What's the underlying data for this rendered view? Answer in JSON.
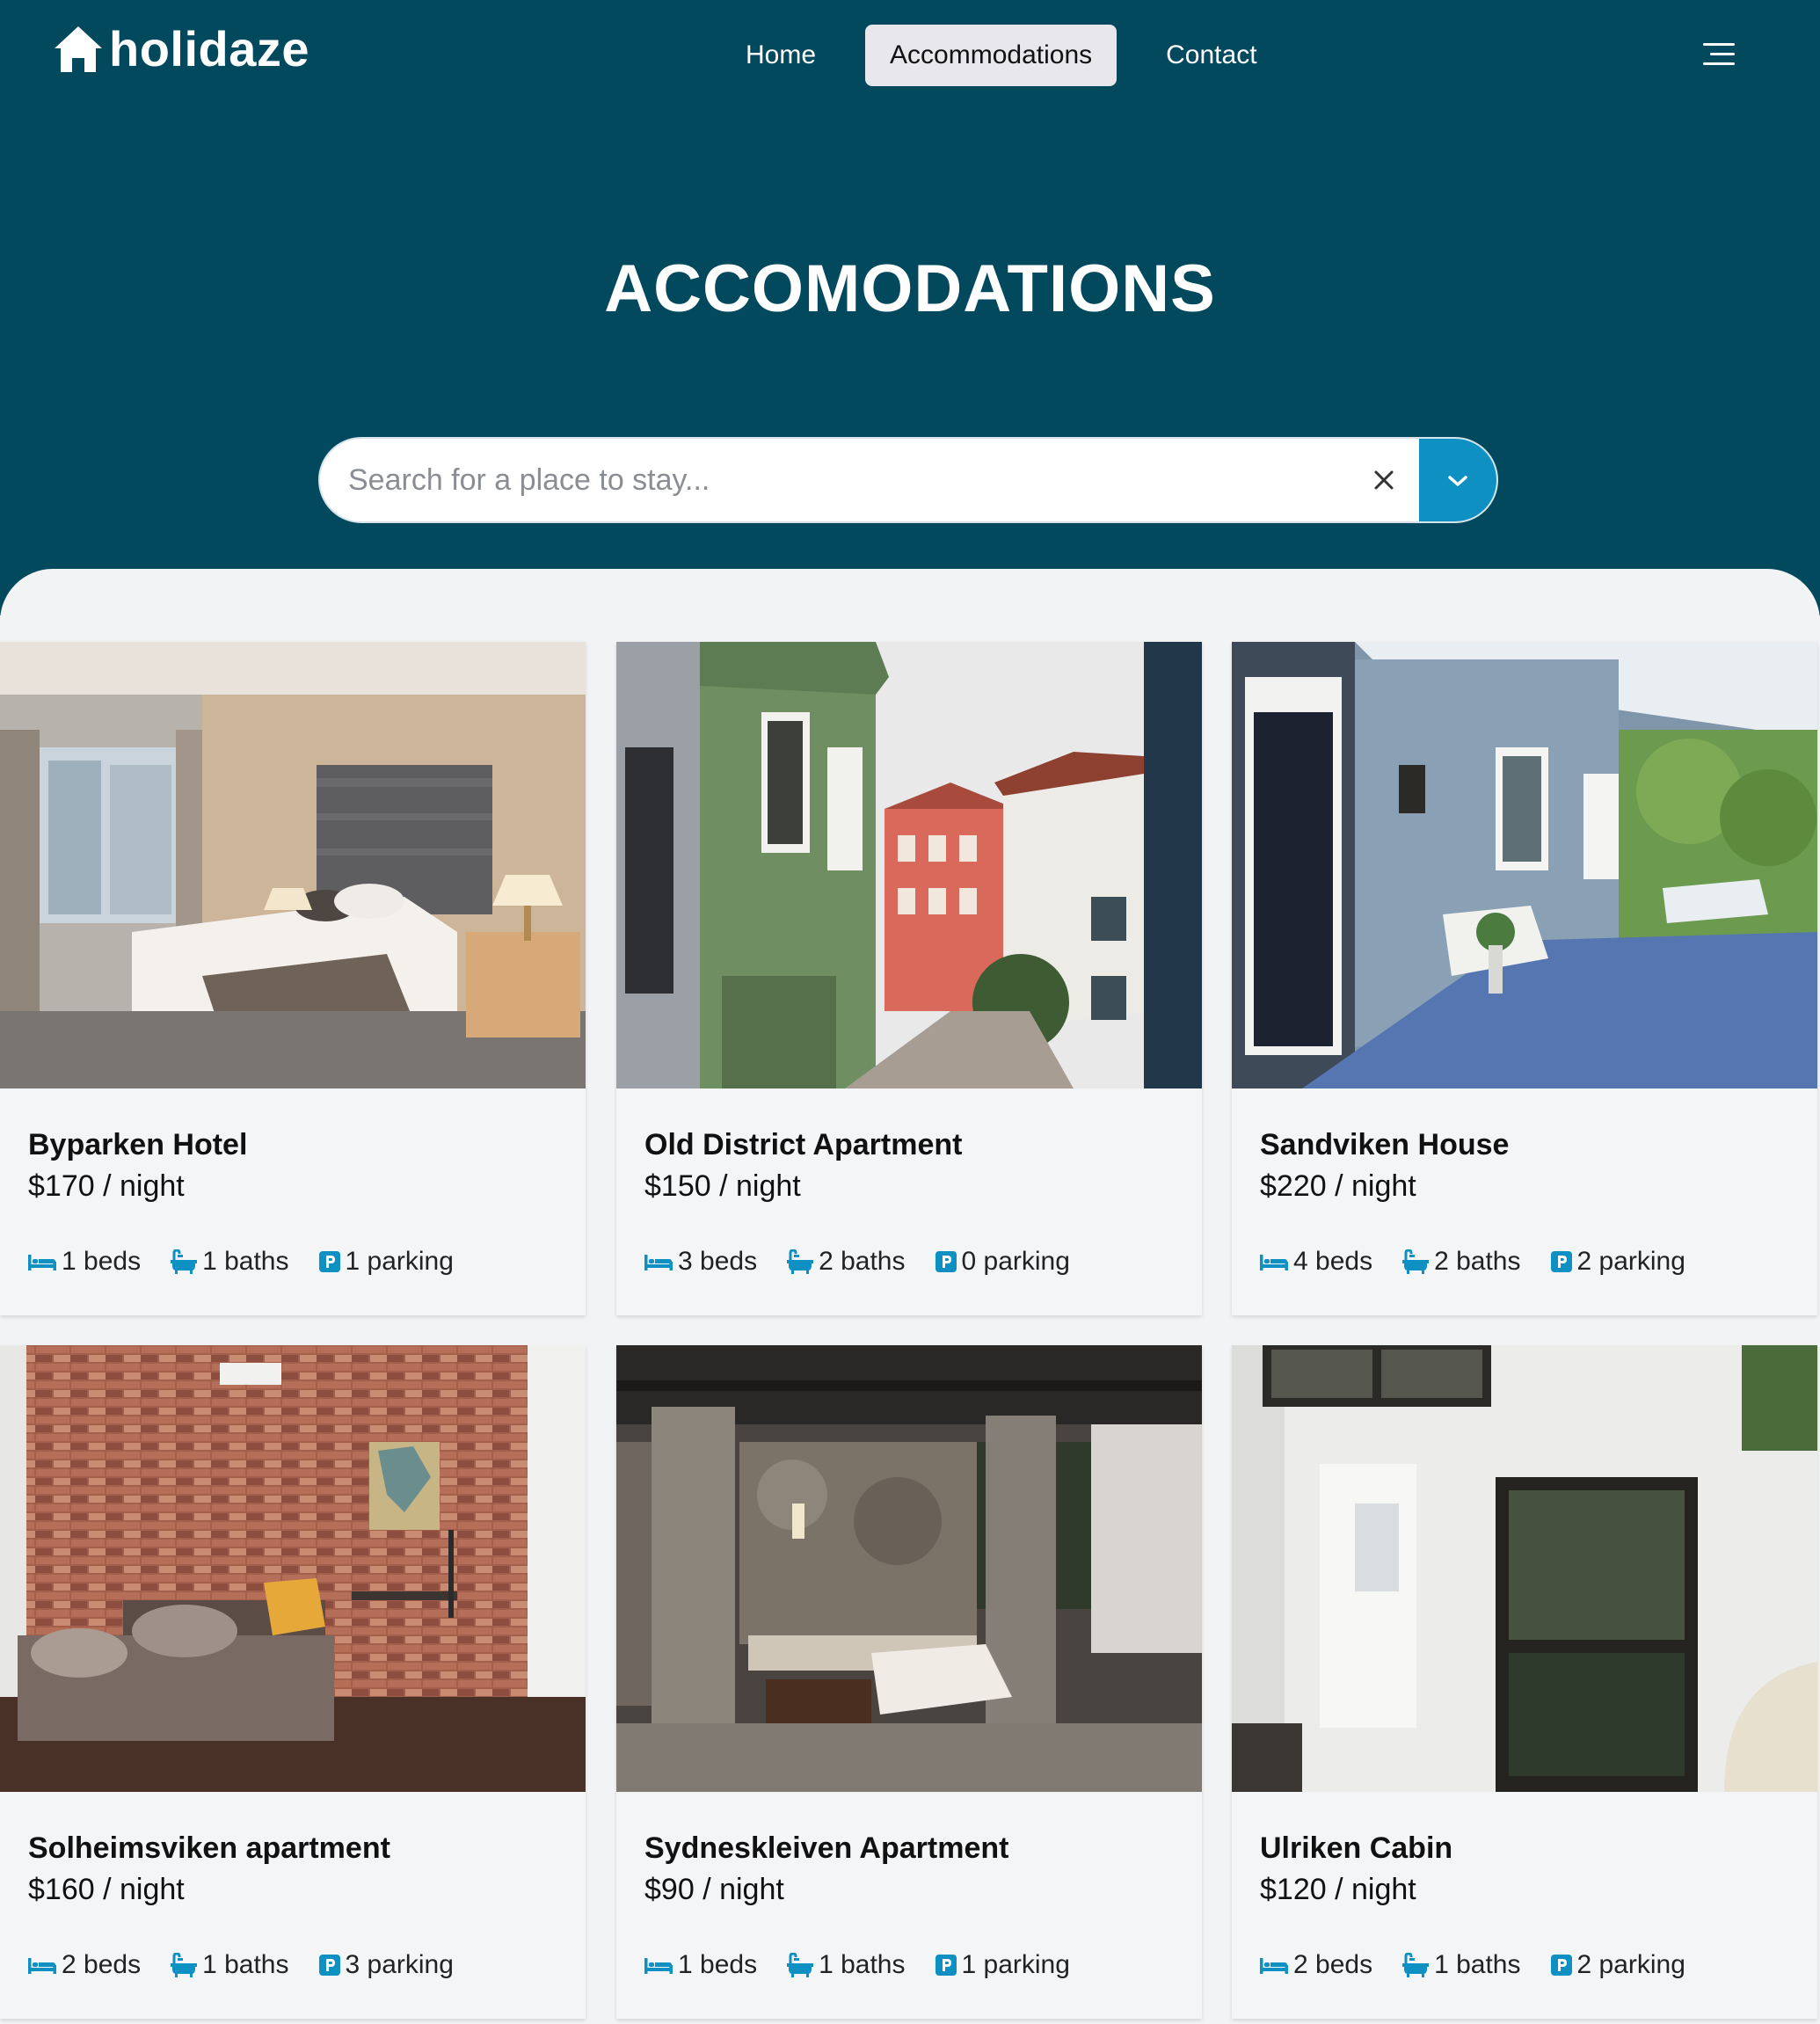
{
  "brand": {
    "name": "holidaze",
    "icon": "house-icon"
  },
  "nav": {
    "links": [
      {
        "label": "Home",
        "active": false
      },
      {
        "label": "Accommodations",
        "active": true
      },
      {
        "label": "Contact",
        "active": false
      }
    ],
    "menu_icon": "hamburger-menu-icon"
  },
  "hero": {
    "title": "ACCOMODATIONS"
  },
  "search": {
    "placeholder": "Search for a place to stay...",
    "value": "",
    "clear_icon": "close-icon",
    "dropdown_icon": "chevron-down-icon"
  },
  "colors": {
    "header_bg": "#03495e",
    "accent": "#0f90c2",
    "page_bg": "#f2f3f5"
  },
  "listings": [
    {
      "name": "Byparken Hotel",
      "price": "$170",
      "per": "/ night",
      "beds": "1 beds",
      "baths": "1 baths",
      "parking": "1 parking",
      "image": "hotel-bedroom-photo"
    },
    {
      "name": "Old District Apartment",
      "price": "$150",
      "per": "/ night",
      "beds": "3 beds",
      "baths": "2 baths",
      "parking": "0 parking",
      "image": "old-town-street-photo"
    },
    {
      "name": "Sandviken House",
      "price": "$220",
      "per": "/ night",
      "beds": "4 beds",
      "baths": "2 baths",
      "parking": "2 parking",
      "image": "blue-porch-house-photo"
    },
    {
      "name": "Solheimsviken apartment",
      "price": "$160",
      "per": "/ night",
      "beds": "2 beds",
      "baths": "1 baths",
      "parking": "3 parking",
      "image": "brick-wall-living-room-photo"
    },
    {
      "name": "Sydneskleiven Apartment",
      "price": "$90",
      "per": "/ night",
      "beds": "1 beds",
      "baths": "1 baths",
      "parking": "1 parking",
      "image": "loft-bedroom-photo"
    },
    {
      "name": "Ulriken Cabin",
      "price": "$120",
      "per": "/ night",
      "beds": "2 beds",
      "baths": "1 baths",
      "parking": "2 parking",
      "image": "white-cabin-photo"
    }
  ]
}
